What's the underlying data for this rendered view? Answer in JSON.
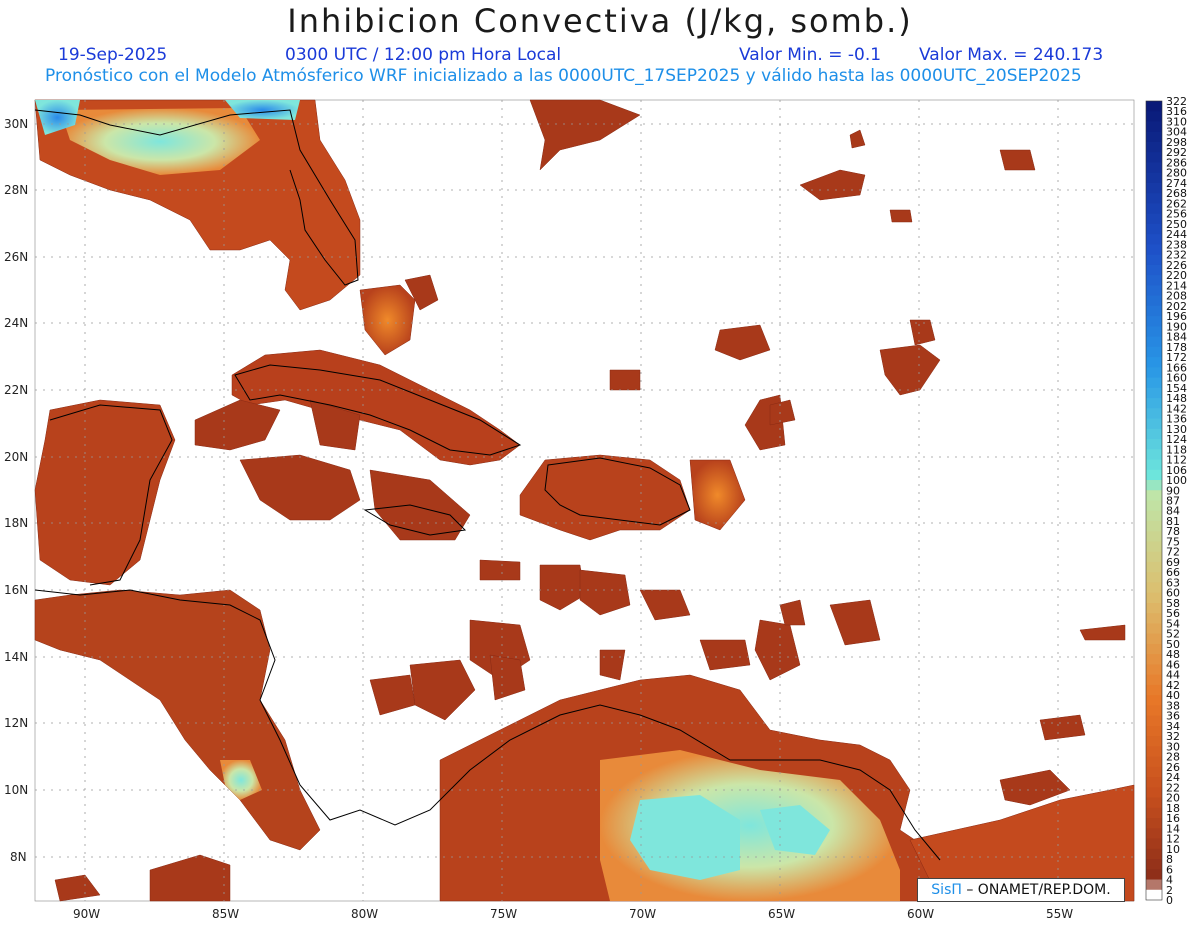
{
  "header": {
    "title": "Inhibicion Convectiva (J/kg, somb.)",
    "date": "19-Sep-2025",
    "time": "0300 UTC / 12:00 pm Hora Local",
    "valmin": "Valor Min. = -0.1",
    "valmax": "Valor Max. = 240.173",
    "forecast": "Pronóstico con el Modelo Atmósferico WRF inicializado a las 0000UTC_17SEP2025 y válido hasta las  0000UTC_20SEP2025"
  },
  "map": {
    "lat_labels": [
      "30N",
      "28N",
      "26N",
      "24N",
      "22N",
      "20N",
      "18N",
      "16N",
      "14N",
      "12N",
      "10N",
      "8N"
    ],
    "lon_labels": [
      "90W",
      "85W",
      "80W",
      "75W",
      "70W",
      "65W",
      "60W",
      "55W"
    ]
  },
  "colorbar": {
    "labels": [
      "322",
      "316",
      "310",
      "304",
      "298",
      "292",
      "286",
      "280",
      "274",
      "268",
      "262",
      "256",
      "250",
      "244",
      "238",
      "232",
      "226",
      "220",
      "214",
      "208",
      "202",
      "196",
      "190",
      "184",
      "178",
      "172",
      "166",
      "160",
      "154",
      "148",
      "142",
      "136",
      "130",
      "124",
      "118",
      "112",
      "106",
      "100",
      "90",
      "87",
      "84",
      "81",
      "78",
      "75",
      "72",
      "69",
      "66",
      "63",
      "60",
      "58",
      "56",
      "54",
      "52",
      "50",
      "48",
      "46",
      "44",
      "42",
      "40",
      "38",
      "36",
      "34",
      "32",
      "30",
      "28",
      "26",
      "24",
      "22",
      "20",
      "18",
      "16",
      "14",
      "12",
      "10",
      "8",
      "6",
      "4",
      "2",
      "0"
    ],
    "colors": {
      "deep_blue": "#0a1a78",
      "blue": "#1e6fe0",
      "cyan": "#6ee8dc",
      "pale_green": "#c8e6a8",
      "tan": "#d8c47a",
      "orange": "#e8661a",
      "rust": "#a8391a",
      "white": "#ffffff"
    }
  },
  "credit": {
    "sis": "SisΠ",
    "rest": "– ONAMET/REP.DOM."
  }
}
